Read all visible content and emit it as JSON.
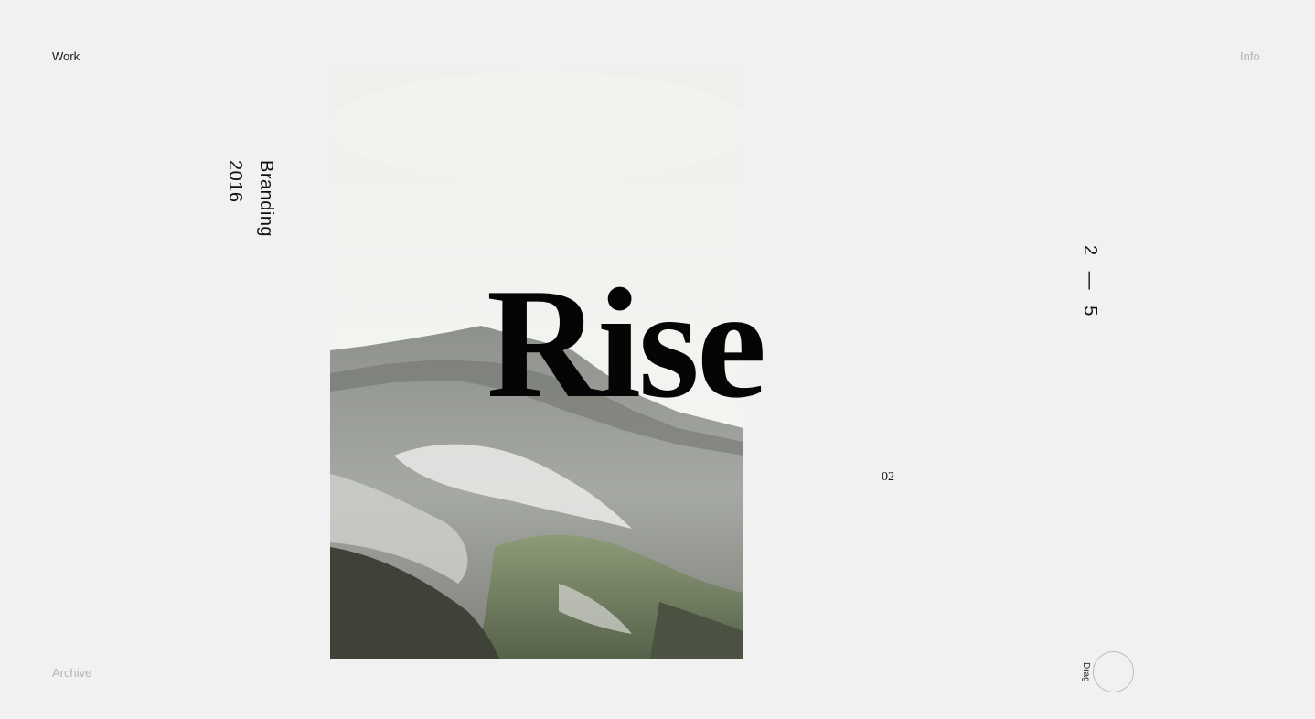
{
  "nav": {
    "work": "Work",
    "info": "Info",
    "archive": "Archive"
  },
  "project": {
    "category": "Branding",
    "year": "2016",
    "title": "Rise",
    "slide_number": "02"
  },
  "pagination": {
    "counter": "2 — 5"
  },
  "drag": {
    "label": "Drag"
  },
  "colors": {
    "background": "#f1f1f2",
    "text": "#111111",
    "muted": "#b3b3b3"
  }
}
